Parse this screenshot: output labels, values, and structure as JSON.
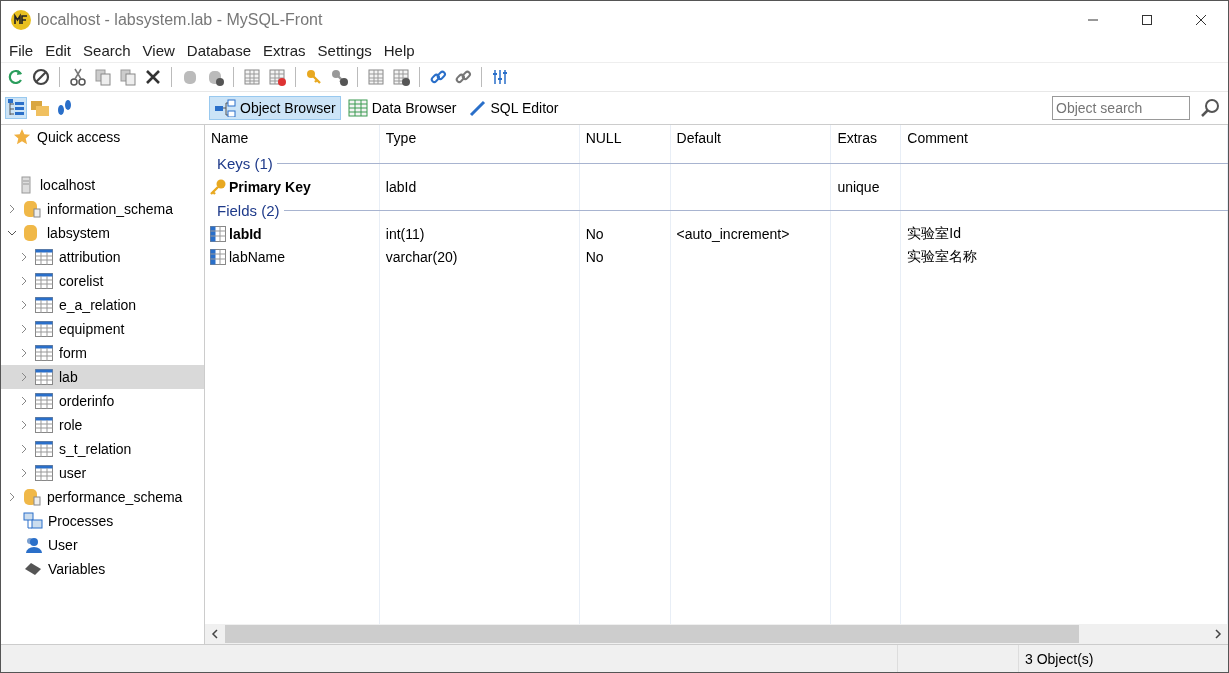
{
  "window": {
    "title": "localhost - labsystem.lab - MySQL-Front"
  },
  "menu": [
    "File",
    "Edit",
    "Search",
    "View",
    "Database",
    "Extras",
    "Settings",
    "Help"
  ],
  "view_tabs": [
    {
      "label": "Object Browser",
      "selected": true
    },
    {
      "label": "Data Browser",
      "selected": false
    },
    {
      "label": "SQL Editor",
      "selected": false
    }
  ],
  "search": {
    "placeholder": "Object search"
  },
  "sidebar": {
    "quick_access": "Quick access",
    "tree": [
      {
        "label": "localhost",
        "kind": "server",
        "children": [
          {
            "label": "information_schema",
            "kind": "system-db",
            "expanded": false,
            "selected": false
          },
          {
            "label": "labsystem",
            "kind": "db",
            "expanded": true,
            "selected": false,
            "children": [
              {
                "label": "attribution",
                "kind": "table",
                "expanded": false,
                "selected": false
              },
              {
                "label": "corelist",
                "kind": "table",
                "expanded": false,
                "selected": false
              },
              {
                "label": "e_a_relation",
                "kind": "table",
                "expanded": false,
                "selected": false
              },
              {
                "label": "equipment",
                "kind": "table",
                "expanded": false,
                "selected": false
              },
              {
                "label": "form",
                "kind": "table",
                "expanded": false,
                "selected": false
              },
              {
                "label": "lab",
                "kind": "table",
                "expanded": false,
                "selected": true
              },
              {
                "label": "orderinfo",
                "kind": "table",
                "expanded": false,
                "selected": false
              },
              {
                "label": "role",
                "kind": "table",
                "expanded": false,
                "selected": false
              },
              {
                "label": "s_t_relation",
                "kind": "table",
                "expanded": false,
                "selected": false
              },
              {
                "label": "user",
                "kind": "table",
                "expanded": false,
                "selected": false
              }
            ]
          },
          {
            "label": "performance_schema",
            "kind": "system-db",
            "expanded": false,
            "selected": false
          },
          {
            "label": "Processes",
            "kind": "processes",
            "selected": false
          },
          {
            "label": "User",
            "kind": "users",
            "selected": false
          },
          {
            "label": "Variables",
            "kind": "variables",
            "selected": false
          }
        ]
      }
    ]
  },
  "table": {
    "columns": [
      "Name",
      "Type",
      "NULL",
      "Default",
      "Extras",
      "Comment"
    ],
    "groups": [
      {
        "title": "Keys (1)",
        "kind": "key",
        "rows": [
          {
            "primary": true,
            "cells": [
              "Primary Key",
              "labId",
              "",
              "",
              "unique",
              ""
            ]
          }
        ]
      },
      {
        "title": "Fields (2)",
        "kind": "field",
        "rows": [
          {
            "primary": true,
            "cells": [
              "labId",
              "int(11)",
              "No",
              "<auto_increment>",
              "",
              "实验室Id"
            ]
          },
          {
            "primary": false,
            "cells": [
              "labName",
              "varchar(20)",
              "No",
              "",
              "",
              "实验室名称"
            ]
          }
        ]
      }
    ]
  },
  "status_bar": {
    "count": "3 Object(s)"
  }
}
